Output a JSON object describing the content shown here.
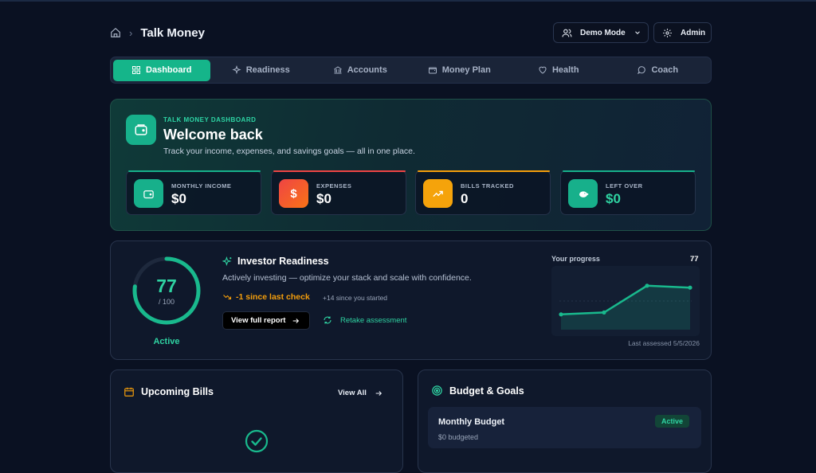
{
  "header": {
    "app_title": "Talk Money",
    "mode_button": "Demo Mode",
    "admin_button": "Admin"
  },
  "nav": {
    "tabs": [
      {
        "label": "Dashboard",
        "icon": "grid-icon",
        "active": true
      },
      {
        "label": "Readiness",
        "icon": "sparkle-icon",
        "active": false
      },
      {
        "label": "Accounts",
        "icon": "bank-icon",
        "active": false
      },
      {
        "label": "Money Plan",
        "icon": "wallet-icon",
        "active": false
      },
      {
        "label": "Health",
        "icon": "heart-icon",
        "active": false
      },
      {
        "label": "Coach",
        "icon": "chat-icon",
        "active": false
      }
    ]
  },
  "welcome": {
    "kicker": "TALK MONEY DASHBOARD",
    "title": "Welcome back",
    "subtitle": "Track your income, expenses, and savings goals — all in one place.",
    "stats": [
      {
        "label": "MONTHLY INCOME",
        "value": "$0",
        "icon": "wallet-icon",
        "color": "#17b08b"
      },
      {
        "label": "EXPENSES",
        "value": "$0",
        "icon": "dollar-icon",
        "color": "#ef4444"
      },
      {
        "label": "BILLS TRACKED",
        "value": "0",
        "icon": "trend-up-icon",
        "color": "#f59e0b"
      },
      {
        "label": "LEFT OVER",
        "value": "$0",
        "icon": "piggy-bank-icon",
        "color": "#17b08b"
      }
    ]
  },
  "readiness": {
    "score": "77",
    "score_value": 77,
    "max": "/ 100",
    "status": "Active",
    "title": "Investor Readiness",
    "description": "Actively investing — optimize your stack and scale with confidence.",
    "delta": "-1 since last check",
    "since_start": "+14 since you started",
    "report_button": "View full report",
    "retake_button": "Retake assessment",
    "progress_label": "Your progress",
    "progress_value": "77",
    "progress_points": [
      63,
      64,
      78,
      77
    ],
    "last_assessed": "Last assessed 5/5/2026"
  },
  "bills": {
    "title": "Upcoming Bills",
    "view_all": "View All"
  },
  "budget": {
    "title": "Budget & Goals",
    "plan_name": "Monthly Budget",
    "plan_sub": "$0 budgeted",
    "plan_status": "Active"
  },
  "colors": {
    "accent": "#15b58a",
    "warning": "#f59e0b",
    "danger": "#ef4444"
  }
}
